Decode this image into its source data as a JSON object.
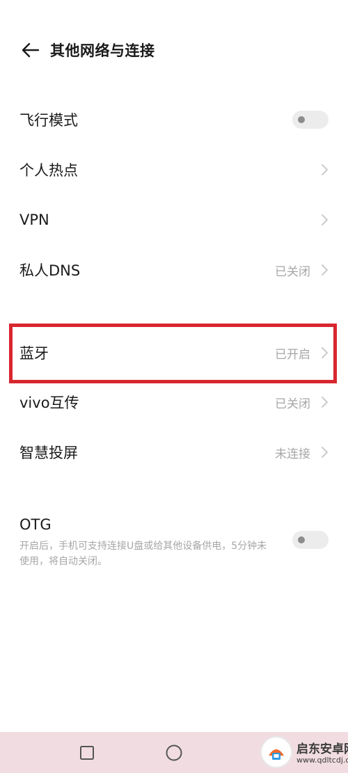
{
  "header": {
    "title": "其他网络与连接",
    "back_icon": "arrow-left-icon"
  },
  "rows": {
    "airplane_mode": {
      "label": "飞行模式",
      "toggle_on": false
    },
    "hotspot": {
      "label": "个人热点"
    },
    "vpn": {
      "label": "VPN"
    },
    "private_dns": {
      "label": "私人DNS",
      "value": "已关闭"
    },
    "bluetooth": {
      "label": "蓝牙",
      "value": "已开启"
    },
    "vivo_share": {
      "label": "vivo互传",
      "value": "已关闭"
    },
    "screen_cast": {
      "label": "智慧投屏",
      "value": "未连接"
    }
  },
  "otg": {
    "label": "OTG",
    "description": "开启后，手机可支持连接U盘或给其他设备供电，5分钟未使用，将自动关闭。",
    "toggle_on": false
  },
  "highlight": {
    "color": "#d8262f"
  },
  "navbar": {
    "recents_icon": "square-icon",
    "home_icon": "circle-icon"
  },
  "watermark": {
    "brand": "启东安卓网",
    "url": "www.qdltcdj.com"
  }
}
